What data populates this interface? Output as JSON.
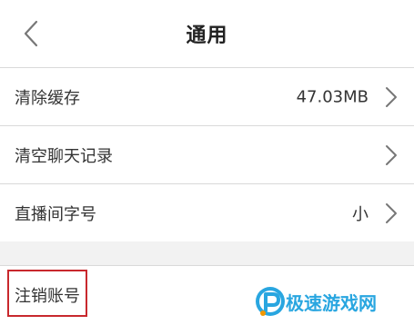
{
  "header": {
    "title": "通用"
  },
  "settings": [
    {
      "label": "清除缓存",
      "value": "47.03MB"
    },
    {
      "label": "清空聊天记录",
      "value": ""
    },
    {
      "label": "直播间字号",
      "value": "小"
    }
  ],
  "account": {
    "delete_label": "注销账号"
  },
  "watermark": {
    "text": "极速游戏网"
  },
  "colors": {
    "highlight_border": "#c8282d",
    "section_gap": "#f2f2f2",
    "divider": "#d9d9d9",
    "watermark": "#29a6e0"
  },
  "icons": {
    "back": "chevron-left-icon",
    "row_arrow": "chevron-right-icon"
  }
}
